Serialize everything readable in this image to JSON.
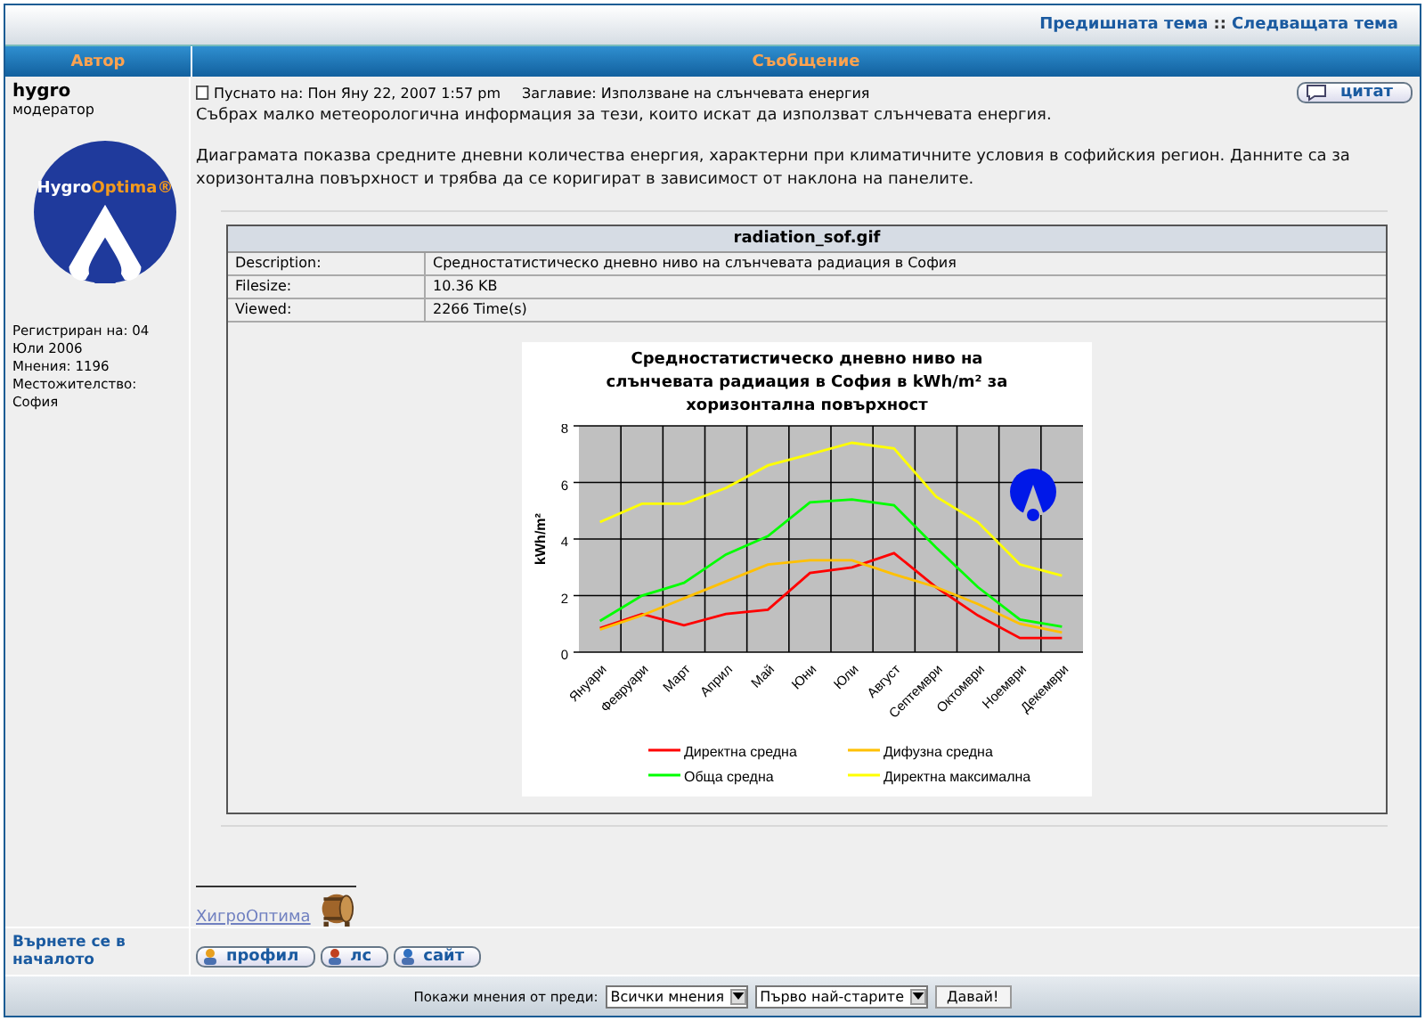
{
  "topic_nav": {
    "previous": "Предишната тема",
    "separator": "::",
    "next": "Следващата тема"
  },
  "columns": [
    "Автор",
    "Съобщение"
  ],
  "post": {
    "author": "hygro",
    "rank": "модератор",
    "avatar_text": [
      "Hygro",
      "Optima®"
    ],
    "profile": [
      "Регистриран на: 04 Юли 2006",
      "Мнения: 1196",
      "Местожителство: София"
    ],
    "posted": "Пуснато на: Пон Яну 22, 2007 1:57 pm",
    "subject": "Заглавие: Използване на слънчевата енергия",
    "quote_button": "цитат",
    "paragraphs": [
      "Събрах малко метеорологична информация за тези, които искат да използват слънчевата енергия.",
      "Диаграмата показва средните дневни количества енергия, характерни при климатичните условия в софийския регион. Данните са за хоризонтална повърхност и трябва да се коригират в зависимост от наклона на панелите."
    ],
    "attachment": {
      "filename": "radiation_sof.gif",
      "rows": [
        {
          "label": "Description:",
          "value": "Средностатистическо дневно ниво на слънчевата радиация в София"
        },
        {
          "label": "Filesize:",
          "value": "10.36 KB"
        },
        {
          "label": "Viewed:",
          "value": "2266 Time(s)"
        }
      ],
      "chart_data": {
        "type": "line",
        "title": "Средностатистическо дневно ниво на слънчевата радиация в София в kWh/m² за хоризонтална повърхност",
        "ylabel": "kWh/m²",
        "categories": [
          "Януари",
          "Февруари",
          "Март",
          "Април",
          "Май",
          "Юни",
          "Юли",
          "Август",
          "Септември",
          "Октомври",
          "Ноември",
          "Декември"
        ],
        "ylim": [
          0,
          8
        ],
        "yticks": [
          0,
          2,
          4,
          6,
          8
        ],
        "grid": true,
        "legend": true,
        "series": [
          {
            "name": "Директна средна",
            "color": "#ff0000",
            "values": [
              0.85,
              1.35,
              0.95,
              1.35,
              1.5,
              2.8,
              3.0,
              3.5,
              2.3,
              1.3,
              0.5,
              0.5
            ]
          },
          {
            "name": "Дифузна средна",
            "color": "#ffc000",
            "values": [
              0.8,
              1.3,
              1.9,
              2.5,
              3.1,
              3.25,
              3.25,
              2.75,
              2.3,
              1.7,
              1.0,
              0.7
            ]
          },
          {
            "name": "Обща средна",
            "color": "#00ff00",
            "values": [
              1.1,
              2.0,
              2.45,
              3.45,
              4.1,
              5.3,
              5.4,
              5.2,
              3.7,
              2.3,
              1.15,
              0.9
            ]
          },
          {
            "name": "Директна максимална",
            "color": "#ffff00",
            "values": [
              4.6,
              5.25,
              5.25,
              5.8,
              6.6,
              7.0,
              7.4,
              7.2,
              5.5,
              4.6,
              3.1,
              2.7
            ]
          }
        ]
      }
    },
    "signature_link": "ХигроОптима"
  },
  "back_to_top": "Върнете се в началото",
  "post_buttons": [
    {
      "kind": "profile",
      "label": "профил"
    },
    {
      "kind": "pm",
      "label": "лс"
    },
    {
      "kind": "www",
      "label": "сайт"
    }
  ],
  "footer": {
    "label": "Покажи мнения от преди:",
    "selects": [
      "Всички мнения",
      "Първо най-старите"
    ],
    "button": "Давай!"
  }
}
